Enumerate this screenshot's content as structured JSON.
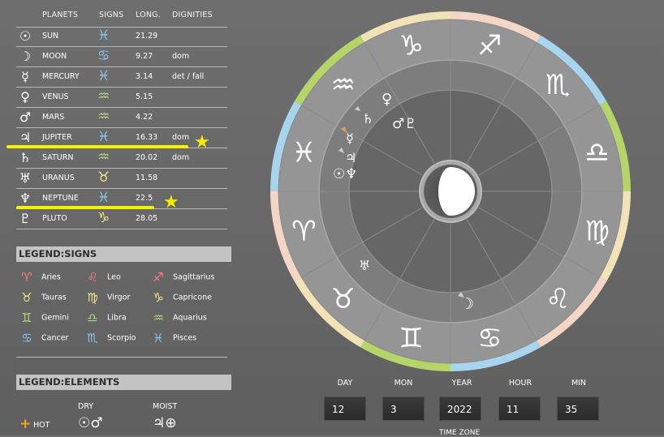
{
  "table": {
    "headers": {
      "planets": "PLANETS",
      "signs": "SIGNS",
      "long": "LONG.",
      "dignities": "DIGNITIES"
    },
    "rows": [
      {
        "symbol": "☉",
        "name": "SUN",
        "sign": "♓",
        "long": "21.29",
        "dignity": ""
      },
      {
        "symbol": "☽",
        "name": "MOON",
        "sign": "♋",
        "long": "9.27",
        "dignity": "dom"
      },
      {
        "symbol": "☿",
        "name": "MERCURY",
        "sign": "♓",
        "long": "3.14",
        "dignity": "det / fall"
      },
      {
        "symbol": "♀",
        "name": "VENUS",
        "sign": "♒",
        "long": "5.15",
        "dignity": ""
      },
      {
        "symbol": "♂",
        "name": "MARS",
        "sign": "♒",
        "long": "4.22",
        "dignity": ""
      },
      {
        "symbol": "♃",
        "name": "JUPITER",
        "sign": "♓",
        "long": "16.33",
        "dignity": "dom"
      },
      {
        "symbol": "♄",
        "name": "SATURN",
        "sign": "♒",
        "long": "20.02",
        "dignity": "dom"
      },
      {
        "symbol": "♅",
        "name": "URANUS",
        "sign": "♉",
        "long": "11.58",
        "dignity": ""
      },
      {
        "symbol": "♆",
        "name": "NEPTUNE",
        "sign": "♓",
        "long": "22.5",
        "dignity": ""
      },
      {
        "symbol": "♇",
        "name": "PLUTO",
        "sign": "♑",
        "long": "28.05",
        "dignity": ""
      }
    ]
  },
  "legend_signs": {
    "title": "LEGEND:SIGNS",
    "items": [
      {
        "glyph": "♈",
        "label": "Aries",
        "color": "#ff7e79"
      },
      {
        "glyph": "♌",
        "label": "Leo",
        "color": "#ff7e79"
      },
      {
        "glyph": "♐",
        "label": "Sagittarius",
        "color": "#ff7e79"
      },
      {
        "glyph": "♉",
        "label": "Tauras",
        "color": "#f6e58d"
      },
      {
        "glyph": "♍",
        "label": "Virgor",
        "color": "#f6e58d"
      },
      {
        "glyph": "♑",
        "label": "Capricone",
        "color": "#f6e58d"
      },
      {
        "glyph": "♊",
        "label": "Gemini",
        "color": "#b5d97a"
      },
      {
        "glyph": "♎",
        "label": "Libra",
        "color": "#b5d97a"
      },
      {
        "glyph": "♒",
        "label": "Aquarius",
        "color": "#b5d97a"
      },
      {
        "glyph": "♋",
        "label": "Cancer",
        "color": "#8ec6ef"
      },
      {
        "glyph": "♏",
        "label": "Scorpio",
        "color": "#8ec6ef"
      },
      {
        "glyph": "♓",
        "label": "Pisces",
        "color": "#8ec6ef"
      }
    ]
  },
  "legend_elements": {
    "title": "LEGEND:ELEMENTS",
    "col_dry": "DRY",
    "col_moist": "MOIST",
    "row_hot_symbol": "+",
    "row_hot": "HOT",
    "dry_symbols": "☉♂",
    "moist_symbols": "♃⊕"
  },
  "wheel": {
    "signs": [
      "♑",
      "♐",
      "♏",
      "♎",
      "♍",
      "♌",
      "♋",
      "♊",
      "♉",
      "♈",
      "♓",
      "♒"
    ],
    "planets": {
      "venus": "♀",
      "saturn": "♄",
      "mars_pluto": "♂♇",
      "mercury": "☿",
      "jupiter": "♃",
      "sun_neptune": "☉♆",
      "uranus": "♅",
      "moon": "☽"
    }
  },
  "datetime": {
    "day_label": "DAY",
    "mon_label": "MON",
    "year_label": "YEAR",
    "hour_label": "HOUR",
    "min_label": "MIN",
    "day": "12",
    "mon": "3",
    "year": "2022",
    "hour": "11",
    "min": "35",
    "timezone_label": "TIME ZONE"
  },
  "colors": {
    "highlight": "#f7f106",
    "star": "#f5ec00",
    "sign_blue": "#8ec6ef",
    "ring_inner": "#808080",
    "ring_outer": "#969696"
  }
}
